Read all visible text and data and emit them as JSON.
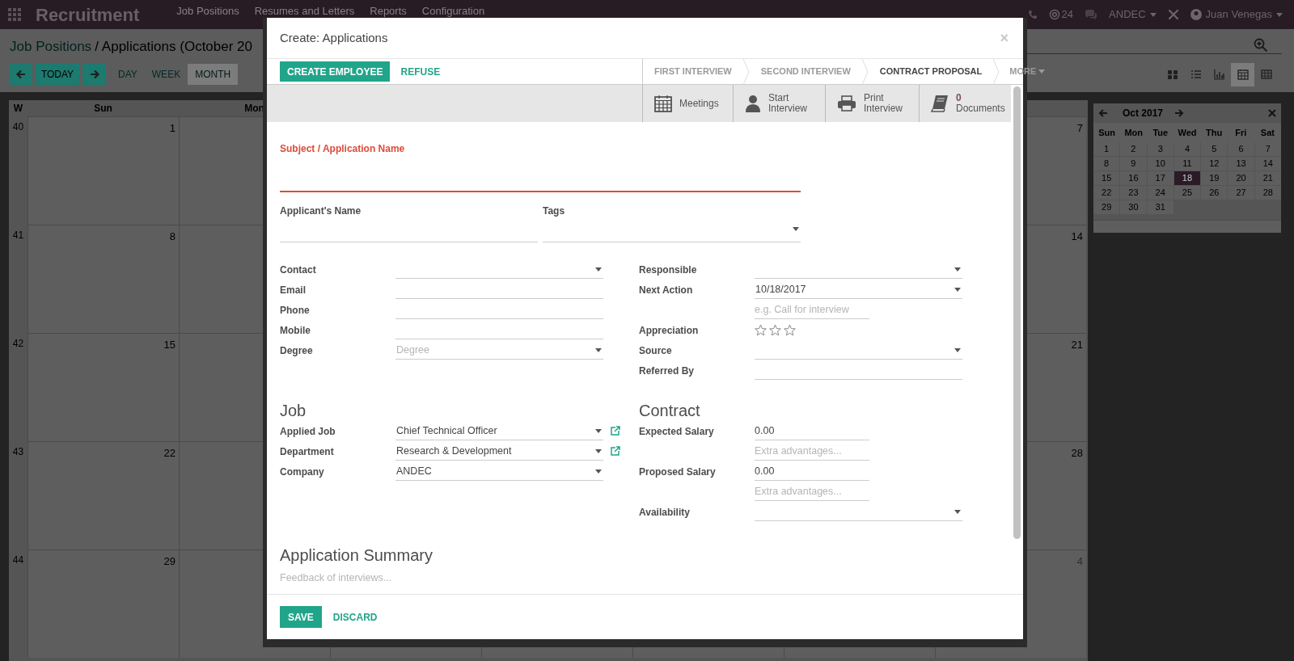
{
  "topbar": {
    "app_title": "Recruitment",
    "menu": [
      "Job Positions",
      "Resumes and Letters",
      "Reports",
      "Configuration"
    ],
    "mentions": "24",
    "company": "ANDEC",
    "user": "Juan Venegas"
  },
  "breadcrumb": {
    "parent": "Job Positions",
    "separator": "/",
    "current": "Applications (October 20"
  },
  "today_button": "TODAY",
  "scales": [
    {
      "label": "DAY",
      "selected": false
    },
    {
      "label": "WEEK",
      "selected": false
    },
    {
      "label": "MONTH",
      "selected": true
    }
  ],
  "views": [
    {
      "kind": "kanban",
      "selected": false
    },
    {
      "kind": "list",
      "selected": false
    },
    {
      "kind": "graph",
      "selected": false
    },
    {
      "kind": "calendar",
      "selected": true
    },
    {
      "kind": "pivot",
      "selected": false
    }
  ],
  "calendar": {
    "week_header": "W",
    "day_headers": [
      "Sun",
      "Mon"
    ],
    "weeks": [
      {
        "week": "40",
        "sun": "1",
        "sat": "7",
        "sat_other_month": false
      },
      {
        "week": "41",
        "sun": "8",
        "sat": "14",
        "sat_other_month": false
      },
      {
        "week": "42",
        "sun": "15",
        "sat": "21",
        "sat_other_month": false
      },
      {
        "week": "43",
        "sun": "22",
        "sat": "28",
        "sat_other_month": false
      },
      {
        "week": "44",
        "sun": "29",
        "sat": "4",
        "sat_other_month": true
      }
    ]
  },
  "mini_calendar": {
    "title": "Oct 2017",
    "day_names": [
      "Sun",
      "Mon",
      "Tue",
      "Wed",
      "Thu",
      "Fri",
      "Sat"
    ],
    "days": [
      {
        "label": "1",
        "selected": false
      },
      {
        "label": "2",
        "selected": false
      },
      {
        "label": "3",
        "selected": false
      },
      {
        "label": "4",
        "selected": false
      },
      {
        "label": "5",
        "selected": false
      },
      {
        "label": "6",
        "selected": false
      },
      {
        "label": "7",
        "selected": false
      },
      {
        "label": "8",
        "selected": false
      },
      {
        "label": "9",
        "selected": false
      },
      {
        "label": "10",
        "selected": false
      },
      {
        "label": "11",
        "selected": false
      },
      {
        "label": "12",
        "selected": false
      },
      {
        "label": "13",
        "selected": false
      },
      {
        "label": "14",
        "selected": false
      },
      {
        "label": "15",
        "selected": false
      },
      {
        "label": "16",
        "selected": false
      },
      {
        "label": "17",
        "selected": false
      },
      {
        "label": "18",
        "selected": true
      },
      {
        "label": "19",
        "selected": false
      },
      {
        "label": "20",
        "selected": false
      },
      {
        "label": "21",
        "selected": false
      },
      {
        "label": "22",
        "selected": false
      },
      {
        "label": "23",
        "selected": false
      },
      {
        "label": "24",
        "selected": false
      },
      {
        "label": "25",
        "selected": false
      },
      {
        "label": "26",
        "selected": false
      },
      {
        "label": "27",
        "selected": false
      },
      {
        "label": "28",
        "selected": false
      },
      {
        "label": "29",
        "selected": false
      },
      {
        "label": "30",
        "selected": false
      },
      {
        "label": "31",
        "selected": false
      }
    ]
  },
  "dialog": {
    "title": "Create: Applications",
    "close": "×",
    "actions": [
      {
        "label": "CREATE EMPLOYEE",
        "primary": true
      },
      {
        "label": "REFUSE",
        "primary": false
      }
    ],
    "stages": [
      {
        "label": "FIRST INTERVIEW",
        "selected": false
      },
      {
        "label": "SECOND INTERVIEW",
        "selected": false
      },
      {
        "label": "CONTRACT PROPOSAL",
        "selected": true
      }
    ],
    "more": "MORE",
    "smart_buttons": [
      {
        "kind": "meetings",
        "label": "Meetings"
      },
      {
        "kind": "interview",
        "label": "Start Interview"
      },
      {
        "kind": "print",
        "label": "Print Interview"
      },
      {
        "kind": "documents",
        "count": "0",
        "label": "Documents"
      }
    ],
    "subject": {
      "label": "Subject / Application Name",
      "required": true
    },
    "applicant_name": {
      "label": "Applicant's Name"
    },
    "tags": {
      "label": "Tags"
    },
    "left_fields": [
      {
        "label": "Contact",
        "kind": "select"
      },
      {
        "label": "Email",
        "kind": "text"
      },
      {
        "label": "Phone",
        "kind": "text"
      },
      {
        "label": "Mobile",
        "kind": "text"
      },
      {
        "label": "Degree",
        "kind": "select",
        "placeholder": "Degree"
      }
    ],
    "right_fields": [
      {
        "label": "Responsible",
        "kind": "select"
      },
      {
        "label": "Next Action",
        "kind": "select",
        "value": "10/18/2017"
      },
      {
        "kind": "short",
        "placeholder": "e.g. Call for interview"
      },
      {
        "label": "Appreciation",
        "kind": "stars",
        "stars": 0
      },
      {
        "label": "Source",
        "kind": "select"
      },
      {
        "label": "Referred By",
        "kind": "text"
      }
    ],
    "job": {
      "heading": "Job",
      "fields": [
        {
          "label": "Applied Job",
          "kind": "select",
          "value": "Chief Technical Officer",
          "external_link": true
        },
        {
          "label": "Department",
          "kind": "select",
          "value": "Research & Development",
          "external_link": true
        },
        {
          "label": "Company",
          "kind": "select",
          "value": "ANDEC",
          "external_link": false
        }
      ]
    },
    "contract": {
      "heading": "Contract",
      "fields": [
        {
          "label": "Expected Salary",
          "kind": "short",
          "value": "0.00"
        },
        {
          "kind": "short",
          "placeholder": "Extra advantages..."
        },
        {
          "label": "Proposed Salary",
          "kind": "short",
          "value": "0.00"
        },
        {
          "kind": "short",
          "placeholder": "Extra advantages..."
        },
        {
          "label": "Availability",
          "kind": "select"
        }
      ]
    },
    "summary": {
      "heading": "Application Summary",
      "placeholder": "Feedback of interviews..."
    },
    "footer": [
      {
        "label": "SAVE",
        "primary": true
      },
      {
        "label": "DISCARD",
        "primary": false
      }
    ]
  }
}
